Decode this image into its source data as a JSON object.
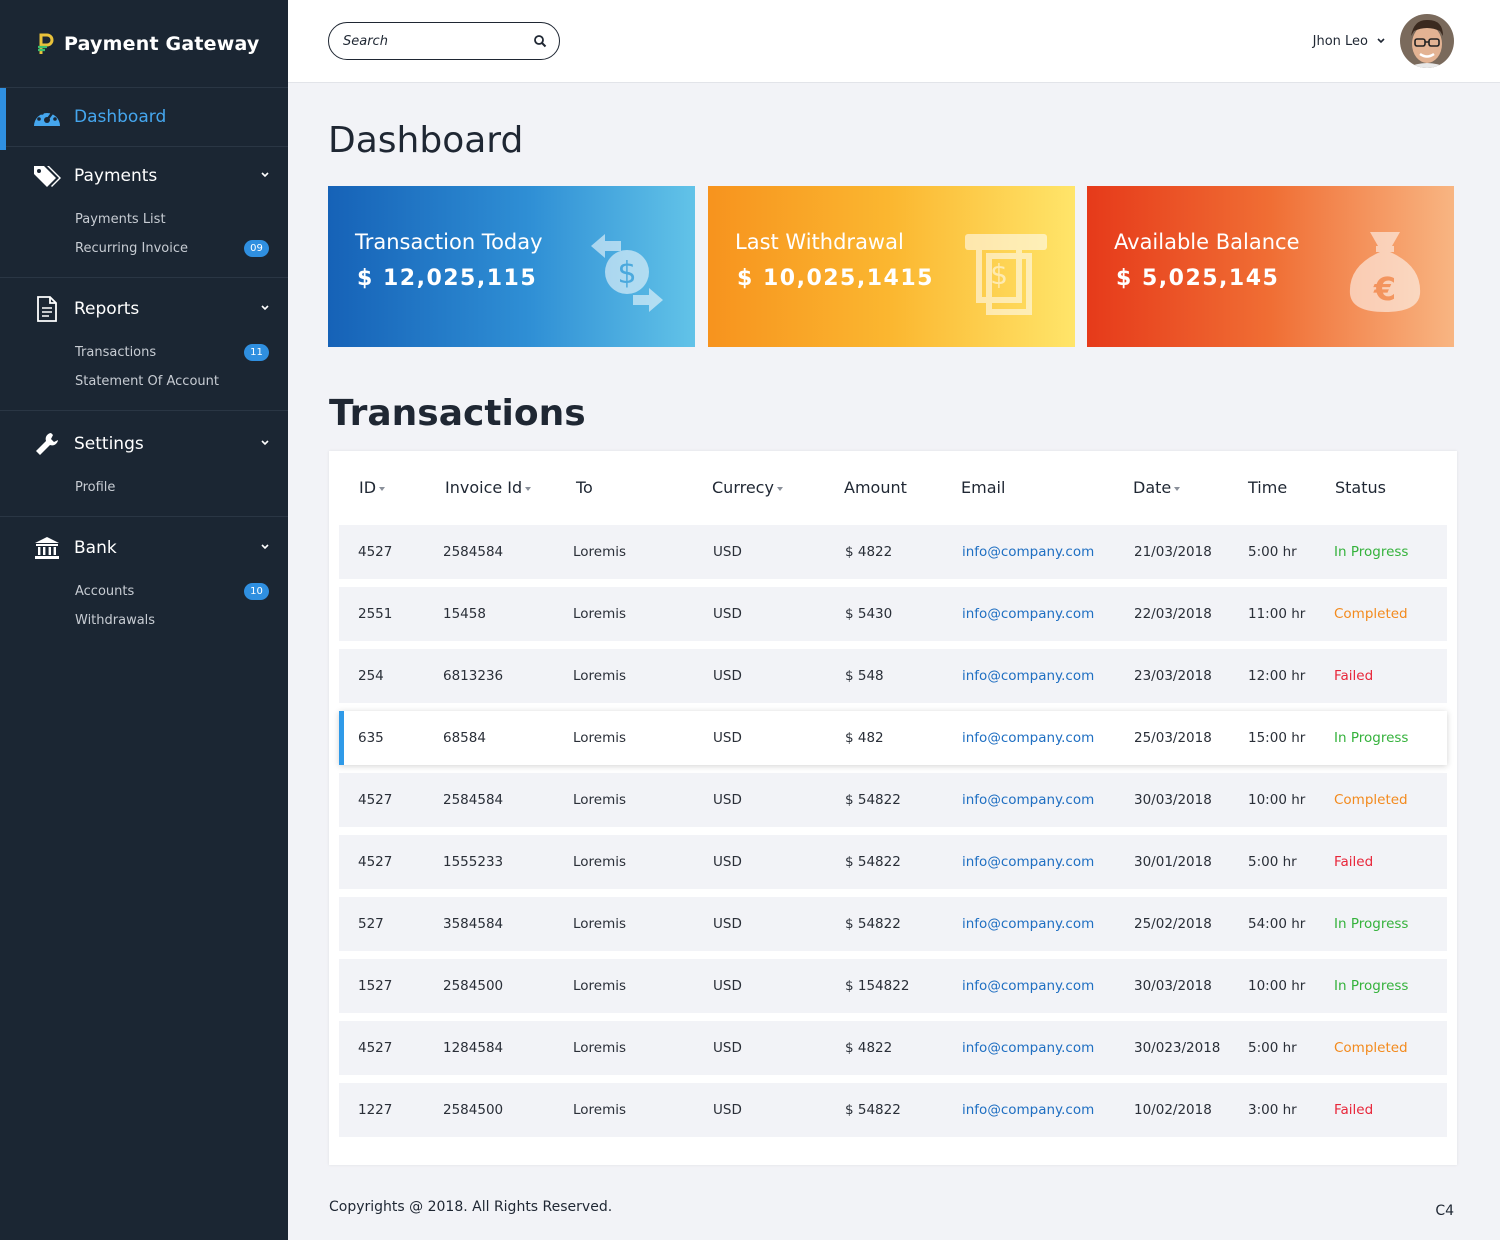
{
  "brand": {
    "name": "Payment Gateway"
  },
  "sidebar": {
    "dashboard": "Dashboard",
    "payments": {
      "label": "Payments",
      "items": [
        {
          "label": "Payments List"
        },
        {
          "label": "Recurring Invoice",
          "badge": "09"
        }
      ]
    },
    "reports": {
      "label": "Reports",
      "items": [
        {
          "label": "Transactions",
          "badge": "11"
        },
        {
          "label": "Statement Of Account"
        }
      ]
    },
    "settings": {
      "label": "Settings",
      "items": [
        {
          "label": "Profile"
        }
      ]
    },
    "bank": {
      "label": "Bank",
      "items": [
        {
          "label": "Accounts",
          "badge": "10"
        },
        {
          "label": "Withdrawals"
        }
      ]
    }
  },
  "header": {
    "search_placeholder": "Search",
    "user_name": "Jhon Leo"
  },
  "page": {
    "title": "Dashboard",
    "section_title": "Transactions"
  },
  "cards": [
    {
      "title": "Transaction Today",
      "value": "$ 12,025,115"
    },
    {
      "title": "Last Withdrawal",
      "value": "$ 10,025,1415"
    },
    {
      "title": "Available Balance",
      "value": "$ 5,025,145"
    }
  ],
  "table": {
    "headers": {
      "id": "ID",
      "invoice": "Invoice Id",
      "to": "To",
      "currency": "Currecy",
      "amount": "Amount",
      "email": "Email",
      "date": "Date",
      "time": "Time",
      "status": "Status"
    },
    "rows": [
      {
        "id": "4527",
        "invoice": "2584584",
        "to": "Loremis",
        "currency": "USD",
        "amount": "$ 4822",
        "email": "info@company.com",
        "date": "21/03/2018",
        "time": "5:00 hr",
        "status": "In Progress"
      },
      {
        "id": "2551",
        "invoice": "15458",
        "to": "Loremis",
        "currency": "USD",
        "amount": "$ 5430",
        "email": "info@company.com",
        "date": "22/03/2018",
        "time": "11:00 hr",
        "status": "Completed"
      },
      {
        "id": "254",
        "invoice": "6813236",
        "to": "Loremis",
        "currency": "USD",
        "amount": "$ 548",
        "email": "info@company.com",
        "date": "23/03/2018",
        "time": "12:00 hr",
        "status": "Failed"
      },
      {
        "id": "635",
        "invoice": "68584",
        "to": "Loremis",
        "currency": "USD",
        "amount": "$ 482",
        "email": "info@company.com",
        "date": "25/03/2018",
        "time": "15:00 hr",
        "status": "In Progress"
      },
      {
        "id": "4527",
        "invoice": "2584584",
        "to": "Loremis",
        "currency": "USD",
        "amount": "$ 54822",
        "email": "info@company.com",
        "date": "30/03/2018",
        "time": "10:00 hr",
        "status": "Completed"
      },
      {
        "id": "4527",
        "invoice": "1555233",
        "to": "Loremis",
        "currency": "USD",
        "amount": "$ 54822",
        "email": "info@company.com",
        "date": "30/01/2018",
        "time": "5:00 hr",
        "status": "Failed"
      },
      {
        "id": "527",
        "invoice": "3584584",
        "to": "Loremis",
        "currency": "USD",
        "amount": "$ 54822",
        "email": "info@company.com",
        "date": "25/02/2018",
        "time": "54:00 hr",
        "status": "In Progress"
      },
      {
        "id": "1527",
        "invoice": "2584500",
        "to": "Loremis",
        "currency": "USD",
        "amount": "$ 154822",
        "email": "info@company.com",
        "date": "30/03/2018",
        "time": "10:00 hr",
        "status": "In Progress"
      },
      {
        "id": "4527",
        "invoice": "1284584",
        "to": "Loremis",
        "currency": "USD",
        "amount": "$ 4822",
        "email": "info@company.com",
        "date": "30/023/2018",
        "time": "5:00 hr",
        "status": "Completed"
      },
      {
        "id": "1227",
        "invoice": "2584500",
        "to": "Loremis",
        "currency": "USD",
        "amount": "$ 54822",
        "email": "info@company.com",
        "date": "10/02/2018",
        "time": "3:00 hr",
        "status": "Failed"
      }
    ]
  },
  "footer": {
    "copyright": "Copyrights @ 2018. All Rights Reserved.",
    "version": "C4"
  },
  "colors": {
    "sidebar_bg": "#1b2633",
    "accent": "#2f8fe0",
    "in_progress": "#35b23c",
    "completed": "#f38a1d",
    "failed": "#e8263a"
  },
  "icons": {
    "dashboard": "speedometer-icon",
    "payments": "tags-icon",
    "reports": "document-icon",
    "settings": "wrench-icon",
    "bank": "bank-icon"
  }
}
